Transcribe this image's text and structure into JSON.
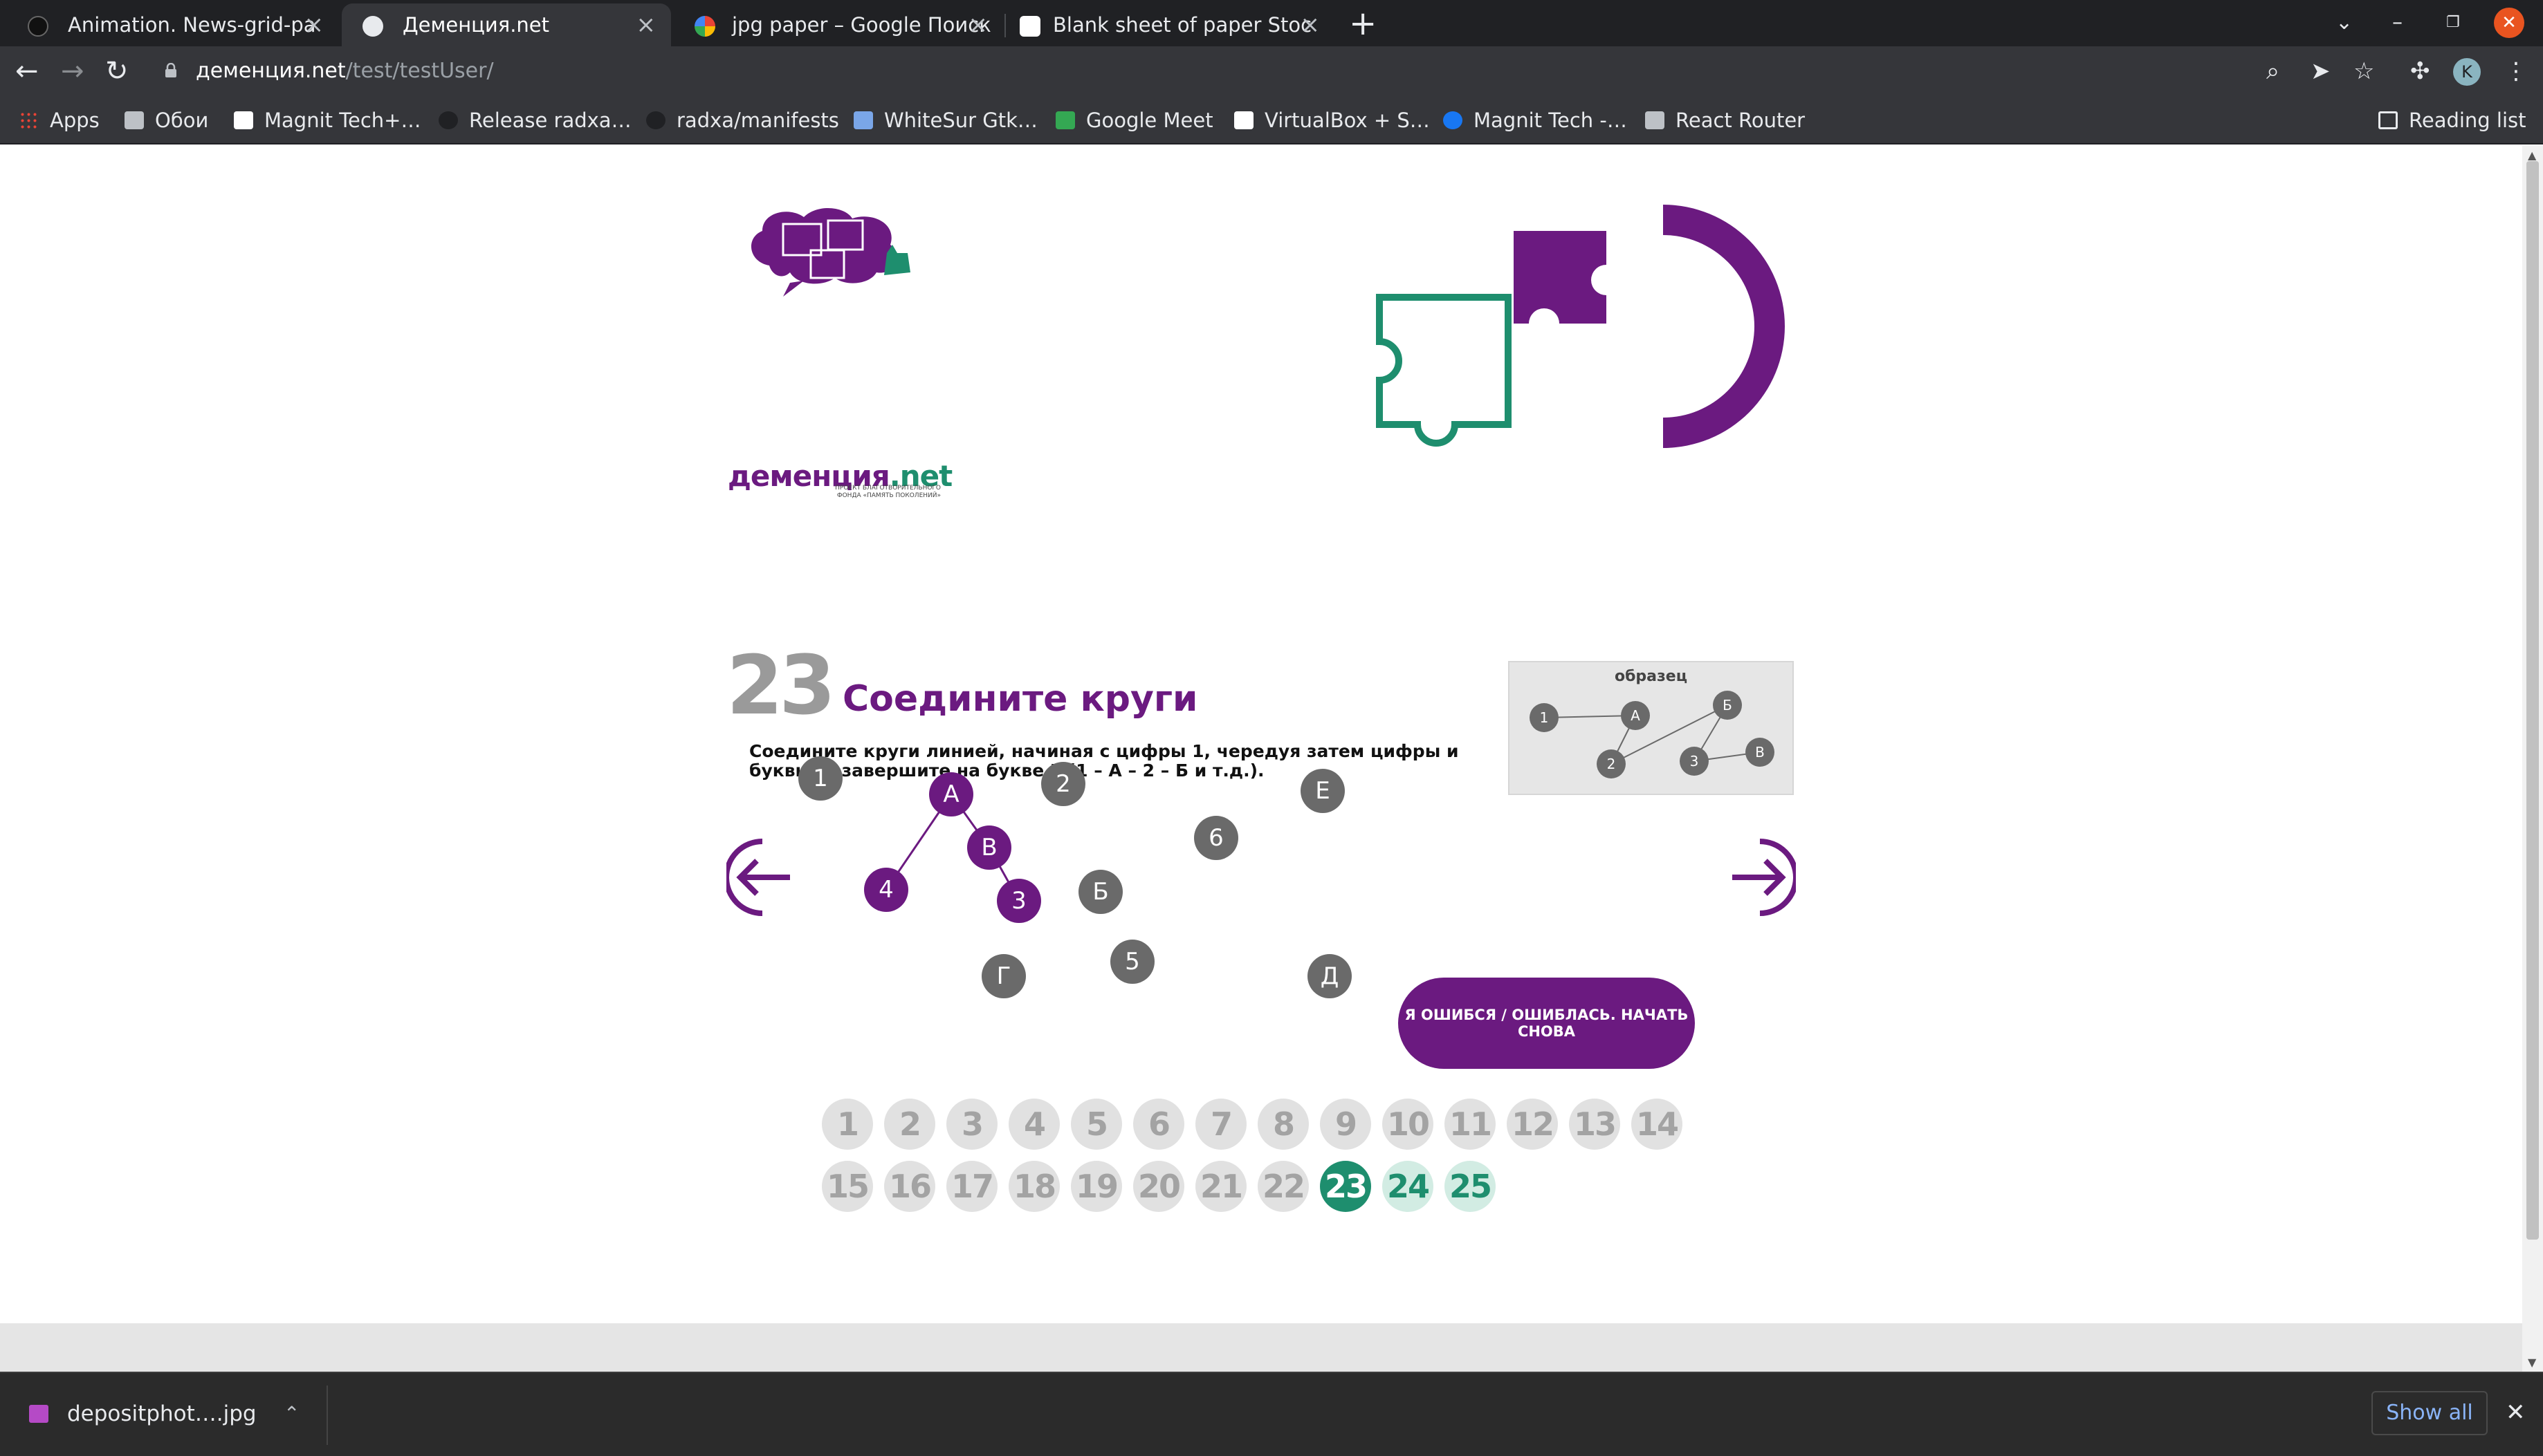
{
  "browser": {
    "tabs": [
      {
        "title": "Animation. News-grid-pa",
        "favicon": "github-icon"
      },
      {
        "title": "Деменция.net",
        "favicon": "globe-icon",
        "active": true
      },
      {
        "title": "jpg paper – Google Поиск",
        "favicon": "google-icon"
      },
      {
        "title": "Blank sheet of paper Stoc",
        "favicon": "depositphotos-icon"
      }
    ],
    "url_host": "деменция.net",
    "url_path": "/test/testUser/",
    "bookmarks": [
      {
        "label": "Apps",
        "icon": "apps-grid-icon"
      },
      {
        "label": "Обои",
        "icon": "folder-icon"
      },
      {
        "label": "Magnit Tech+…",
        "icon": "it-icon"
      },
      {
        "label": "Release radxa…",
        "icon": "github-icon"
      },
      {
        "label": "radxa/manifests",
        "icon": "github-icon"
      },
      {
        "label": "WhiteSur Gtk…",
        "icon": "gtk-icon"
      },
      {
        "label": "Google Meet",
        "icon": "meet-icon"
      },
      {
        "label": "VirtualBox + S…",
        "icon": "notion-icon"
      },
      {
        "label": "Magnit Tech -…",
        "icon": "facebook-icon"
      },
      {
        "label": "React Router",
        "icon": "folder-icon"
      }
    ],
    "reading_list": "Reading list",
    "profile_initial": "K"
  },
  "page": {
    "brand_name": "деменция",
    "brand_tld": ".net",
    "brand_subtitle": "ПРОЕКТ БЛАГОТВОРИТЕЛЬНОГО ФОНДА «ПАМЯТЬ ПОКОЛЕНИЙ»",
    "question_number": "23",
    "question_title": "Соедините круги",
    "question_text": "Соедините круги линией, начиная с цифры 1, чередуя затем цифры и буквы, и завершите на букве Е (1 – А – 2 – Б и т.д.).",
    "sample": {
      "title": "образец",
      "circles": [
        "1",
        "А",
        "2",
        "Б",
        "3",
        "В"
      ]
    },
    "circles": [
      {
        "label": "1",
        "selected": false
      },
      {
        "label": "А",
        "selected": true
      },
      {
        "label": "2",
        "selected": false
      },
      {
        "label": "В",
        "selected": true
      },
      {
        "label": "Б",
        "selected": false
      },
      {
        "label": "4",
        "selected": true
      },
      {
        "label": "3",
        "selected": true
      },
      {
        "label": "6",
        "selected": false
      },
      {
        "label": "Е",
        "selected": false
      },
      {
        "label": "Г",
        "selected": false
      },
      {
        "label": "5",
        "selected": false
      },
      {
        "label": "Д",
        "selected": false
      }
    ],
    "restart_button": "Я ОШИБСЯ / ОШИБЛАСЬ. НАЧАТЬ СНОВА",
    "pagination": {
      "pages": [
        "1",
        "2",
        "3",
        "4",
        "5",
        "6",
        "7",
        "8",
        "9",
        "10",
        "11",
        "12",
        "13",
        "14",
        "15",
        "16",
        "17",
        "18",
        "19",
        "20",
        "21",
        "22",
        "23",
        "24",
        "25"
      ],
      "current": "23",
      "upcoming": [
        "24",
        "25"
      ]
    },
    "colors": {
      "purple": "#6b1a80",
      "green": "#1e8e6e",
      "grey": "#6a6a6a"
    }
  },
  "download": {
    "filename": "depositphot….jpg",
    "show_all": "Show all"
  }
}
